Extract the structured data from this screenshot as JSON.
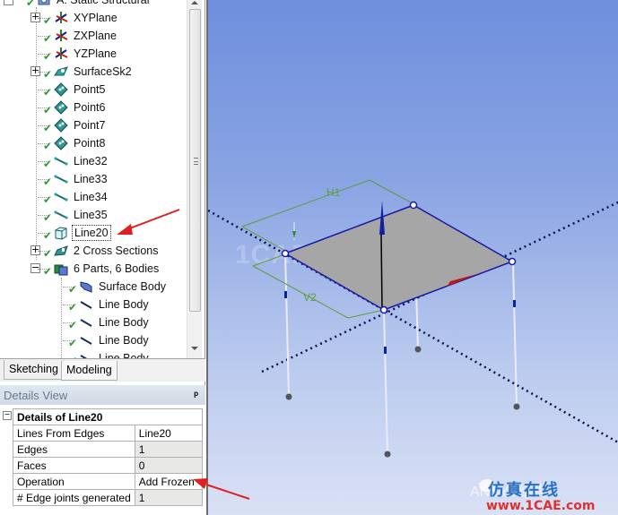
{
  "tree": {
    "root": {
      "label": "A: Static Structural",
      "icon": "static-structural-icon",
      "expanded": true
    },
    "items": [
      {
        "label": "XYPlane",
        "icon": "plane-axes-icon",
        "expandable": true,
        "status": "ok"
      },
      {
        "label": "ZXPlane",
        "icon": "plane-axes-icon",
        "expandable": false,
        "status": "ok"
      },
      {
        "label": "YZPlane",
        "icon": "plane-axes-icon",
        "expandable": false,
        "status": "ok"
      },
      {
        "label": "SurfaceSk2",
        "icon": "surface-sketch-icon",
        "expandable": true,
        "status": "ok"
      },
      {
        "label": "Point5",
        "icon": "point-feature-icon",
        "status": "ok"
      },
      {
        "label": "Point6",
        "icon": "point-feature-icon",
        "status": "ok"
      },
      {
        "label": "Point7",
        "icon": "point-feature-icon",
        "status": "ok"
      },
      {
        "label": "Point8",
        "icon": "point-feature-icon",
        "status": "ok"
      },
      {
        "label": "Line32",
        "icon": "line-feature-icon",
        "status": "ok"
      },
      {
        "label": "Line33",
        "icon": "line-feature-icon",
        "status": "ok"
      },
      {
        "label": "Line34",
        "icon": "line-feature-icon",
        "status": "ok"
      },
      {
        "label": "Line35",
        "icon": "line-feature-icon",
        "status": "ok"
      },
      {
        "label": "Line20",
        "icon": "lines-from-edges-icon",
        "status": "ok",
        "selected": true
      },
      {
        "label": "2 Cross Sections",
        "icon": "cross-section-icon",
        "expandable": true,
        "status": "ok"
      },
      {
        "label": "6 Parts, 6 Bodies",
        "icon": "parts-bodies-icon",
        "expandable": true,
        "expanded": true,
        "status": "ok"
      }
    ],
    "bodies": [
      {
        "label": "Surface Body",
        "icon": "surface-body-icon"
      },
      {
        "label": "Line Body",
        "icon": "line-body-icon"
      },
      {
        "label": "Line Body",
        "icon": "line-body-icon"
      },
      {
        "label": "Line Body",
        "icon": "line-body-icon"
      },
      {
        "label": "Line Body",
        "icon": "line-body-icon"
      }
    ]
  },
  "tabs": [
    {
      "label": "Sketching",
      "active": false
    },
    {
      "label": "Modeling",
      "active": true
    }
  ],
  "details_view": {
    "title": "Details View",
    "pin_icon": "pin-icon",
    "section_title": "Details of Line20",
    "rows": [
      {
        "key": "Lines From Edges",
        "value": "Line20",
        "readonly": false
      },
      {
        "key": "Edges",
        "value": "1",
        "readonly": true
      },
      {
        "key": "Faces",
        "value": "0",
        "readonly": true
      },
      {
        "key": "Operation",
        "value": "Add Frozen",
        "readonly": false
      },
      {
        "key": "# Edge joints generated",
        "value": "1",
        "readonly": true
      }
    ]
  },
  "viewport": {
    "dimension_labels": {
      "h": "H1",
      "v": "V2"
    },
    "watermark": "1CAE.COM",
    "brand_faded": "ANSYS结构",
    "brand_cn": "仿真在线",
    "brand_url": "www.1CAE.com"
  },
  "colors": {
    "surface_fill": "#a6a6a6",
    "edge_blue": "#1a1aa8",
    "dimension_green": "#5f9c3c",
    "annotation_arrow": "#e02020",
    "axis_x_red": "#c01818",
    "axis_y_green": "#228b22",
    "axis_z_blue": "#1020a0"
  }
}
